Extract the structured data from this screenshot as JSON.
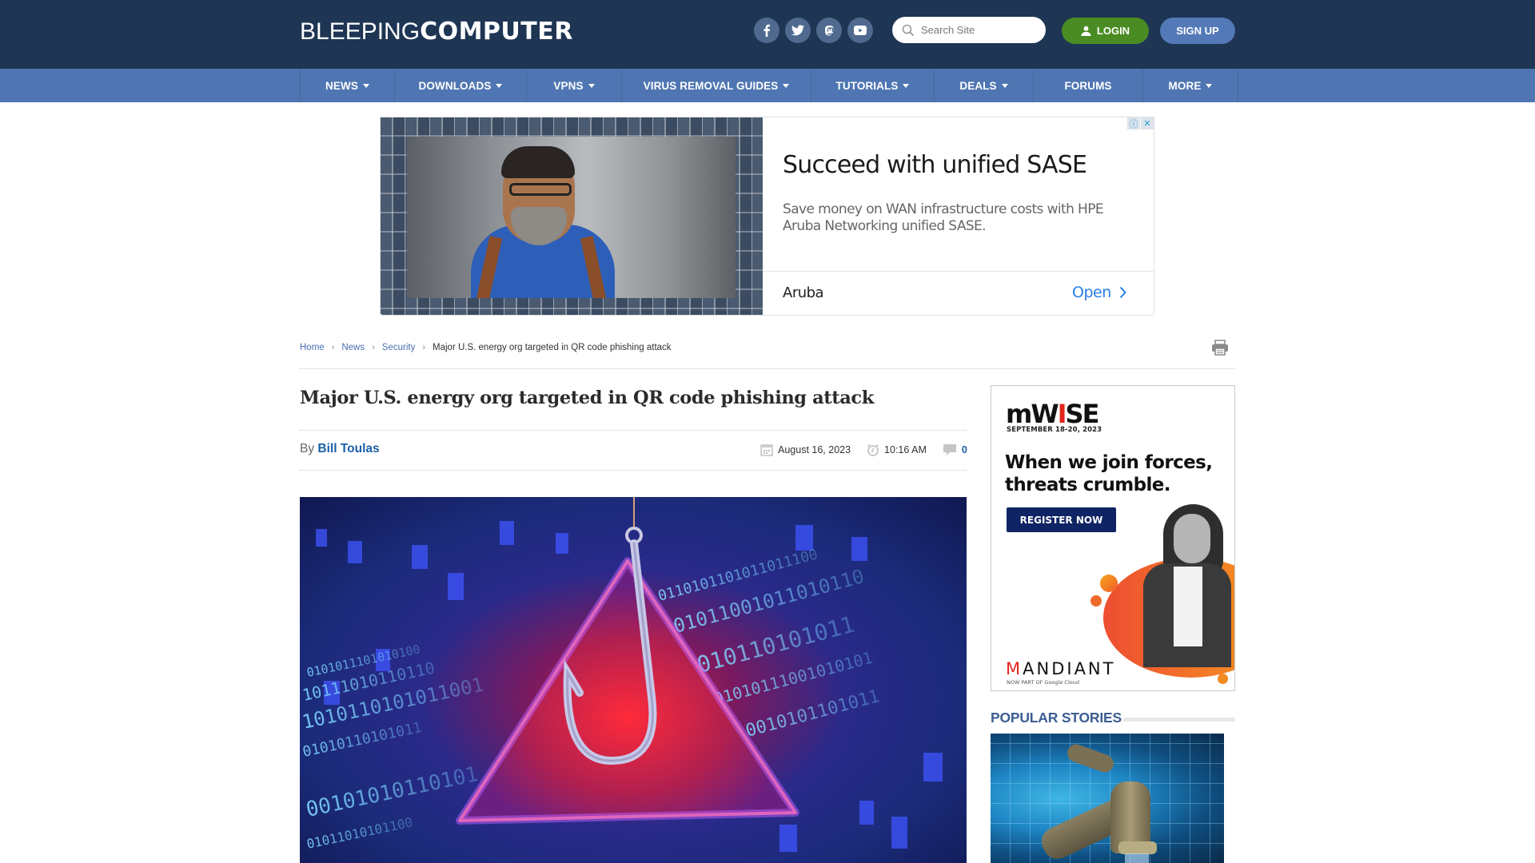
{
  "header": {
    "logo_light": "BLEEPING",
    "logo_bold": "COMPUTER",
    "socials": [
      {
        "name": "facebook-icon"
      },
      {
        "name": "twitter-icon"
      },
      {
        "name": "mastodon-icon"
      },
      {
        "name": "youtube-icon"
      }
    ],
    "search_placeholder": "Search Site",
    "login_label": "LOGIN",
    "signup_label": "SIGN UP"
  },
  "nav": {
    "items": [
      {
        "label": "NEWS",
        "dropdown": true
      },
      {
        "label": "DOWNLOADS",
        "dropdown": true
      },
      {
        "label": "VPNS",
        "dropdown": true
      },
      {
        "label": "VIRUS REMOVAL GUIDES",
        "dropdown": true
      },
      {
        "label": "TUTORIALS",
        "dropdown": true
      },
      {
        "label": "DEALS",
        "dropdown": true
      },
      {
        "label": "FORUMS",
        "dropdown": false
      },
      {
        "label": "MORE",
        "dropdown": true
      }
    ]
  },
  "top_ad": {
    "headline": "Succeed with unified SASE",
    "description": "Save money on WAN infrastructure costs with HPE Aruba Networking unified SASE.",
    "advertiser": "Aruba",
    "cta": "Open",
    "info_glyph": "ⓘ",
    "close_glyph": "✕"
  },
  "breadcrumb": {
    "items": [
      "Home",
      "News",
      "Security"
    ],
    "current": "Major U.S. energy org targeted in QR code phishing attack",
    "separator": "›"
  },
  "article": {
    "title": "Major U.S. energy org targeted in QR code phishing attack",
    "by_label": "By",
    "author": "Bill Toulas",
    "date": "August 16, 2023",
    "time": "10:16 AM",
    "comments": "0"
  },
  "side_ad": {
    "brand_prefix": "mW",
    "brand_accent": "I",
    "brand_suffix": "SE",
    "event_date": "SEPTEMBER 18-20, 2023",
    "headline_line1": "When we join forces,",
    "headline_line2": "threats crumble.",
    "cta": "REGISTER NOW",
    "sponsor_accent": "M",
    "sponsor_rest": "ANDIANT",
    "sponsor_tag": "NOW PART OF Google Cloud"
  },
  "sidebar": {
    "popular_title": "POPULAR STORIES"
  },
  "colors": {
    "header_bg": "#1e3554",
    "nav_bg": "#4f76b2",
    "login_green": "#4a8c23",
    "signup_blue": "#5379b8",
    "link_blue": "#1b5fa8",
    "popular_blue": "#3c5d93"
  }
}
